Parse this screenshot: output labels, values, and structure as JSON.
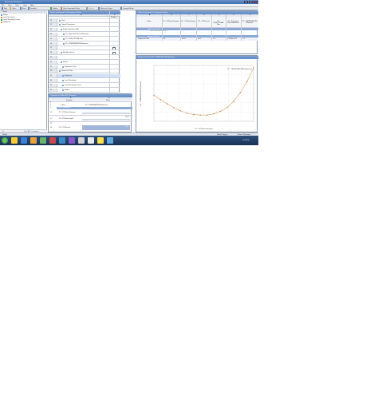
{
  "window": {
    "title": "Exercise4a - Workbench"
  },
  "menu": [
    "File",
    "View",
    "Tools",
    "Units",
    "Help"
  ],
  "toolbar": [
    "New",
    "Open...",
    "Save",
    "Save As..."
  ],
  "toolbar2": [
    "Update",
    "Clear Generated Points",
    "Refresh",
    "Return to Project",
    "Compact Mode"
  ],
  "left": {
    "header": "Charts",
    "items": [
      "Spider",
      "Local Sensitivity",
      "Local Sensitivity Curves",
      "Response"
    ],
    "footer": "View All / Customize..."
  },
  "outline": {
    "header": "Outline of Schematic C5: Response Surface",
    "col_a": "A",
    "col_b": "B",
    "col_b_label": "Enabled",
    "rows": [
      {
        "num": "11",
        "label": "Chart"
      },
      {
        "num": "12",
        "label": "Output Parameters"
      },
      {
        "num": "13",
        "label": "Explicit Dynamics (B1)"
      },
      {
        "num": "14",
        "label": "P3 - Equivalent Stress Maximum"
      },
      {
        "num": "15",
        "label": "P4 - DIRECTIONAL Max"
      },
      {
        "num": "16",
        "label": "P5 - TEMPERATURE Maximum"
      },
      {
        "num": "17",
        "label": ""
      },
      {
        "num": "18",
        "label": "Min-Max Search"
      },
      {
        "num": "19",
        "label": ""
      },
      {
        "num": "20",
        "label": "Metrics"
      },
      {
        "num": "21",
        "label": "Goodness Of Fit"
      },
      {
        "num": "22",
        "label": "Response Point"
      },
      {
        "num": "23",
        "label": "Response"
      },
      {
        "num": "24",
        "label": "Local Sensitivity"
      },
      {
        "num": "25",
        "label": "Local Sensitivity Curves"
      },
      {
        "num": "26",
        "label": "Spider"
      }
    ]
  },
  "props": {
    "header": "Properties of Outline A23: Response",
    "col_a": "A",
    "col_b": "B",
    "col_a_label": "Property",
    "col_b_label": "Value",
    "rows": [
      {
        "num": "1",
        "label": "",
        "value": ""
      },
      {
        "num": "2",
        "label": "Y Axis",
        "value": "P5 - TEMPERATURE Maximum"
      },
      {
        "num": "3",
        "label": "Input Parameters",
        "value": ""
      },
      {
        "num": "11",
        "label": "P1 - XYPlane.Diameter",
        "value": ""
      },
      {
        "num": "12",
        "label": "P2 - XYPlane.Depth",
        "value": "100.1"
      },
      {
        "num": "13",
        "label": "",
        "value": ""
      },
      {
        "num": "14",
        "label": "P3 - XYPlane.H",
        "value": "0.4"
      }
    ]
  },
  "table": {
    "header": "Table of Schematic C5: Response Surface",
    "col_letters": [
      "A",
      "B",
      "C",
      "D",
      "E",
      "F",
      "G"
    ],
    "col_names": [
      "Name",
      "P1 - XYPlane.Diameter",
      "P2 - XYPlane.Depth",
      "P3 - XYPlane.H",
      "P4 - DIRECTIONAL Max",
      "P5 - Equivalent Stress Maximum",
      "P6 - TEMPERATURE Maximum"
    ],
    "section_refine": "Refinement Points",
    "new_refine": "New Refinement Point",
    "section_response": "Response Points",
    "response_row": [
      "Response Point",
      "30",
      "100.1",
      "0.05",
      "0.4",
      "1.3094E+005",
      "1.3"
    ]
  },
  "chart": {
    "header": "Response Chart for P5 - TEMPERATURE Maximum",
    "legend": "P5 - TEMPERATURE Maximum",
    "xlabel": "P1 - XYPlane.Diameter",
    "ylabel": "P5 - TEMPERATURE Maximum"
  },
  "chart_data": {
    "type": "line",
    "x": [
      20,
      22,
      24,
      26,
      28,
      30,
      32,
      34,
      36,
      38,
      40,
      42,
      44,
      46,
      48,
      50
    ],
    "series": [
      {
        "name": "P5 - TEMPERATURE Maximum",
        "values": [
          0.62,
          0.55,
          0.48,
          0.42,
          0.37,
          0.33,
          0.31,
          0.3,
          0.3,
          0.32,
          0.36,
          0.42,
          0.52,
          0.66,
          0.84,
          1.06
        ]
      }
    ],
    "xlim": [
      20,
      50
    ],
    "ylim": [
      0.2,
      1.1
    ],
    "xlabel": "P1 - XYPlane.Diameter",
    "ylabel": "P5 - TEMPERATURE Maximum",
    "title": "",
    "grid": true,
    "legend_position": "top-right"
  },
  "status": {
    "text": "Ready",
    "right1": "Show Progress",
    "right2": "Show 0 Messages"
  },
  "taskbar": {
    "time": "11:39 PM"
  },
  "colors": {
    "accent": "#5d86c2",
    "selection": "#cfe0f7",
    "curve": "#d4a060",
    "taskbar": "#1a3357"
  }
}
